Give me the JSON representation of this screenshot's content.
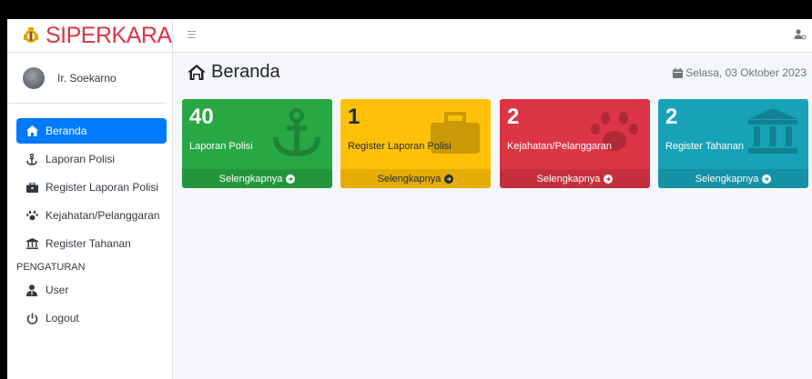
{
  "brand": {
    "name": "SIPERKARA"
  },
  "user": {
    "name": "Ir. Soekarno"
  },
  "sidebar": {
    "items": [
      {
        "label": "Beranda",
        "icon": "home-icon"
      },
      {
        "label": "Laporan Polisi",
        "icon": "anchor-icon"
      },
      {
        "label": "Register Laporan Polisi",
        "icon": "briefcase-icon"
      },
      {
        "label": "Kejahatan/Pelanggaran",
        "icon": "paw-icon"
      },
      {
        "label": "Register Tahanan",
        "icon": "landmark-icon"
      }
    ],
    "section_header": "PENGATURAN",
    "settings": [
      {
        "label": "User",
        "icon": "user-tie-icon"
      },
      {
        "label": "Logout",
        "icon": "power-icon"
      }
    ]
  },
  "header": {
    "title": "Beranda",
    "date": "Selasa, 03 Oktober 2023"
  },
  "boxes": [
    {
      "value": "40",
      "label": "Laporan Polisi",
      "link": "Selengkapnya",
      "color": "#28a745",
      "icon": "anchor-icon"
    },
    {
      "value": "1",
      "label": "Register Laporan Polisi",
      "link": "Selengkapnya",
      "color": "#ffc107",
      "icon": "briefcase-icon"
    },
    {
      "value": "2",
      "label": "Kejahatan/Pelanggaran",
      "link": "Selengkapnya",
      "color": "#dc3545",
      "icon": "paw-icon"
    },
    {
      "value": "2",
      "label": "Register Tahanan",
      "link": "Selengkapnya",
      "color": "#17a2b8",
      "icon": "landmark-icon"
    }
  ],
  "colors": {
    "active": "#007bff",
    "brand": "#dc3545"
  }
}
